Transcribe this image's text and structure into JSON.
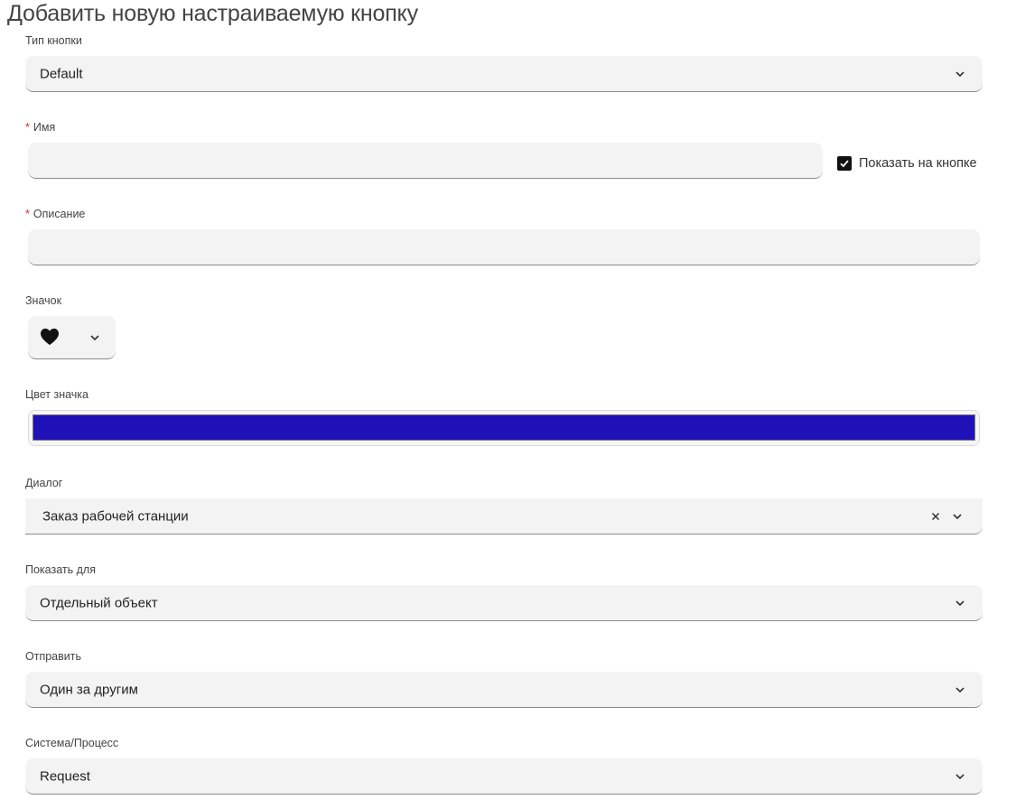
{
  "page": {
    "title": "Добавить новую настраиваемую кнопку"
  },
  "button_type": {
    "label": "Тип кнопки",
    "value": "Default"
  },
  "name": {
    "required_mark": "*",
    "label": "Имя",
    "value": "",
    "show_on_button_label": "Показать на кнопке",
    "show_on_button_checked": true
  },
  "description": {
    "required_mark": "*",
    "label": "Описание",
    "value": ""
  },
  "icon": {
    "label": "Значок",
    "selected_icon": "heart-icon"
  },
  "icon_color": {
    "label": "Цвет значка",
    "value": "#2010b8"
  },
  "dialog": {
    "label": "Диалог",
    "value": "Заказ рабочей станции"
  },
  "show_for": {
    "label": "Показать для",
    "value": "Отдельный объект"
  },
  "send": {
    "label": "Отправить",
    "value": "Один за другим"
  },
  "system_process": {
    "label": "Система/Процесс",
    "value": "Request"
  }
}
